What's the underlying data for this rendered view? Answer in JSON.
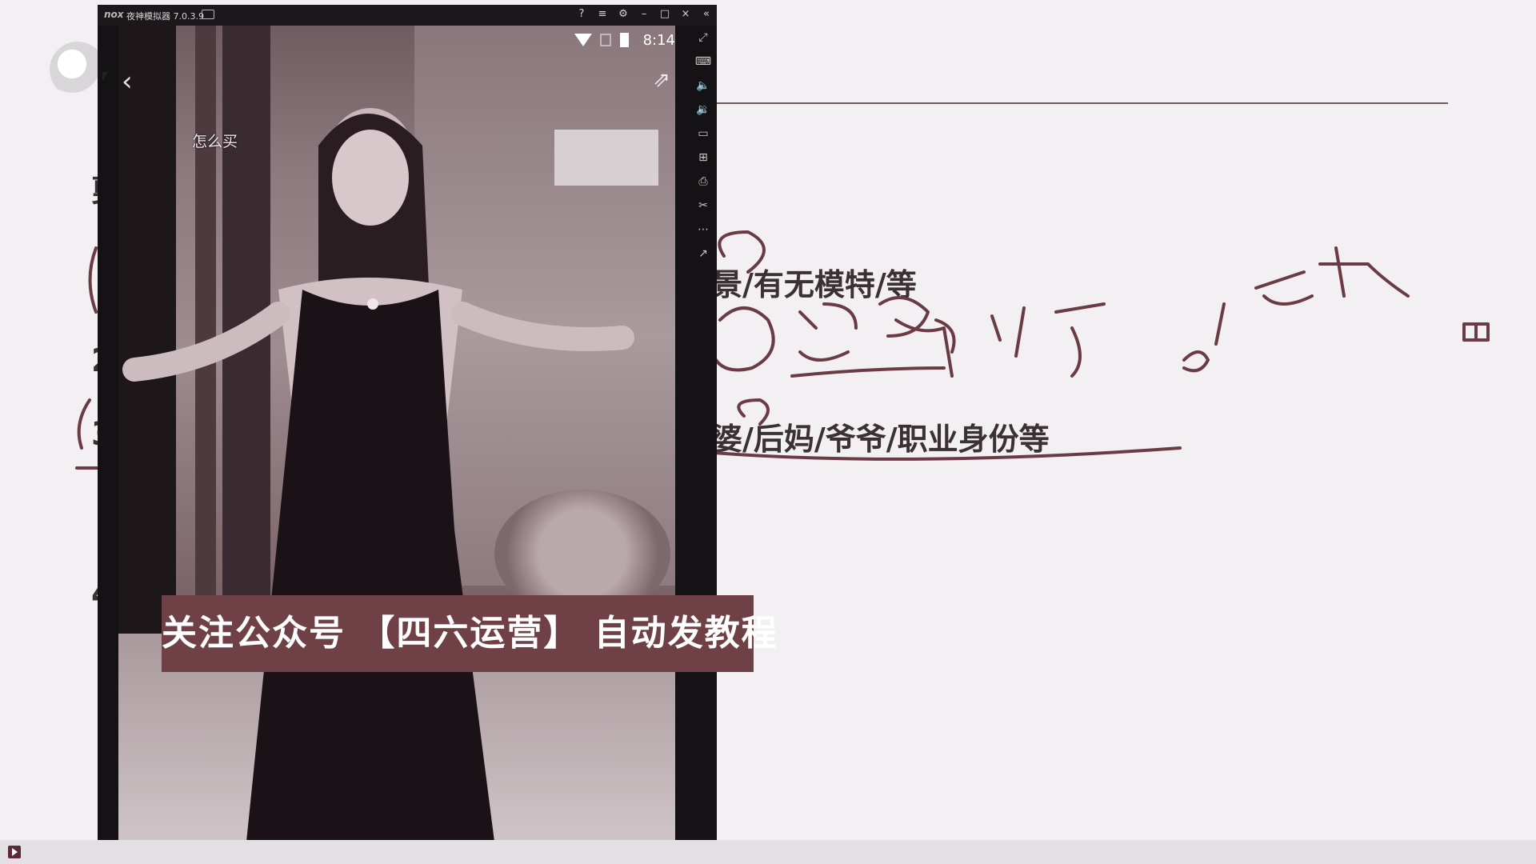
{
  "emulator": {
    "brand": "nox",
    "title": "夜神模拟器 7.0.3.9",
    "window_controls": [
      "?",
      "≡",
      "⚙",
      "–",
      "□",
      "×",
      "«"
    ],
    "side_tools": [
      "fullscreen-icon",
      "keyboard-icon",
      "volume-up-icon",
      "volume-down-icon",
      "screen-icon",
      "apk-icon",
      "print-icon",
      "scissors-icon",
      "more-icon",
      "open-external-icon"
    ]
  },
  "phone": {
    "status_time": "8:14",
    "overlay_label": "怎么买",
    "caption": "关注公众号 【四六运营】 自动发教程"
  },
  "slide": {
    "line1_text": "景/有无模特/等",
    "line2_text": "婆/后妈/爷爷/职业身份等",
    "left_glyphs": [
      "剪",
      "1",
      "2",
      "3",
      "4"
    ]
  },
  "colors": {
    "board": "#f2f0f2",
    "caption_bg": "#6f4046",
    "ink": "#6a3b44",
    "text": "#3b3134"
  }
}
